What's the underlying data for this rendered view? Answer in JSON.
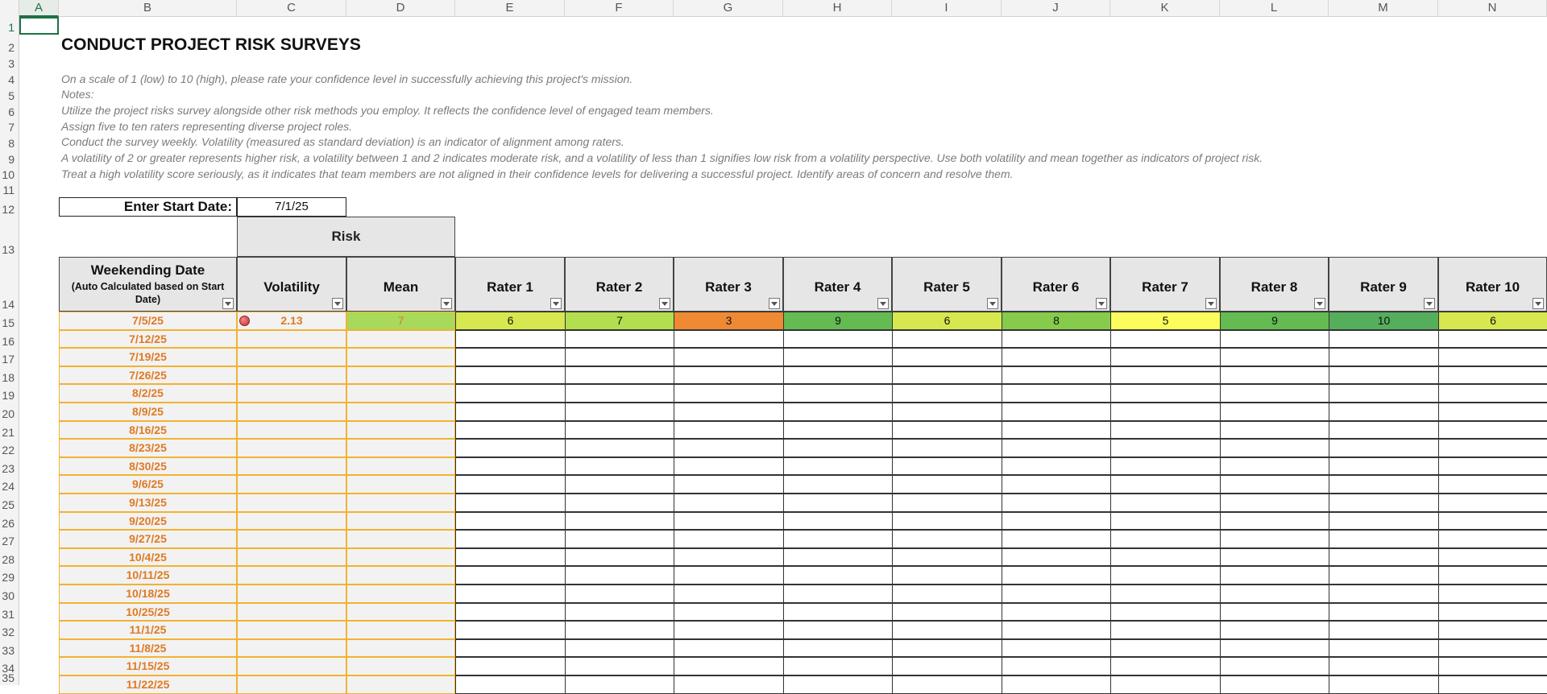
{
  "columns": [
    "A",
    "B",
    "C",
    "D",
    "E",
    "F",
    "G",
    "H",
    "I",
    "J",
    "K",
    "L",
    "M",
    "N"
  ],
  "rows": [
    "1",
    "2",
    "3",
    "4",
    "5",
    "6",
    "7",
    "8",
    "9",
    "10",
    "11",
    "12",
    "13",
    "14",
    "15",
    "16",
    "17",
    "18",
    "19",
    "20",
    "21",
    "22",
    "23",
    "24",
    "25",
    "26",
    "27",
    "28",
    "29",
    "30",
    "31",
    "32",
    "33",
    "34",
    "35"
  ],
  "sheet": {
    "title": "CONDUCT PROJECT RISK SURVEYS",
    "notes": [
      "On a scale of 1 (low) to 10 (high), please rate your confidence level in successfully achieving this project's mission.",
      "Notes:",
      "Utilize the project risks survey alongside other risk methods you employ. It reflects the confidence level of engaged team members.",
      "Assign five to ten raters representing diverse project roles.",
      "Conduct the survey weekly. Volatility (measured as standard deviation) is an indicator of alignment among raters.",
      "A volatility of 2 or greater represents higher risk, a volatility between 1 and 2 indicates moderate risk, and a volatility of less than 1 signifies low risk from a volatility perspective. Use both volatility and mean together as indicators of project risk.",
      "Treat a high volatility score seriously, as it indicates that team members are not aligned in their confidence levels for delivering a successful project. Identify areas of concern and resolve them."
    ],
    "start_date_label": "Enter Start Date:",
    "start_date_value": "7/1/25",
    "risk_header": "Risk"
  },
  "table": {
    "date_header": "Weekending Date",
    "date_subheader": "(Auto Calculated based on Start Date)",
    "volatility_header": "Volatility",
    "mean_header": "Mean",
    "rater_headers": [
      "Rater 1",
      "Rater 2",
      "Rater 3",
      "Rater 4",
      "Rater 5",
      "Rater 6",
      "Rater 7",
      "Rater 8",
      "Rater 9",
      "Rater 10"
    ],
    "dates": [
      "7/5/25",
      "7/12/25",
      "7/19/25",
      "7/26/25",
      "8/2/25",
      "8/9/25",
      "8/16/25",
      "8/23/25",
      "8/30/25",
      "9/6/25",
      "9/13/25",
      "9/20/25",
      "9/27/25",
      "10/4/25",
      "10/11/25",
      "10/18/25",
      "10/25/25",
      "11/1/25",
      "11/8/25",
      "11/15/25",
      "11/22/25"
    ],
    "first_row": {
      "volatility": "2.13",
      "mean": "7",
      "ratings": [
        "6",
        "7",
        "3",
        "9",
        "6",
        "8",
        "5",
        "9",
        "10",
        "6"
      ]
    }
  },
  "colors": {
    "rating_scale": {
      "3": "#ef8a33",
      "5": "#fcfc5c",
      "6": "#d6e84e",
      "7": "#b3de4f",
      "8": "#86cb4c",
      "9": "#63bb52",
      "10": "#54ae5c"
    },
    "mean_fill": "#a8d95a",
    "accent": "#1e7145",
    "date_text": "#e07a22"
  },
  "icons": {
    "volatility_indicator": "red-circle-icon",
    "filter": "filter-dropdown-icon"
  }
}
